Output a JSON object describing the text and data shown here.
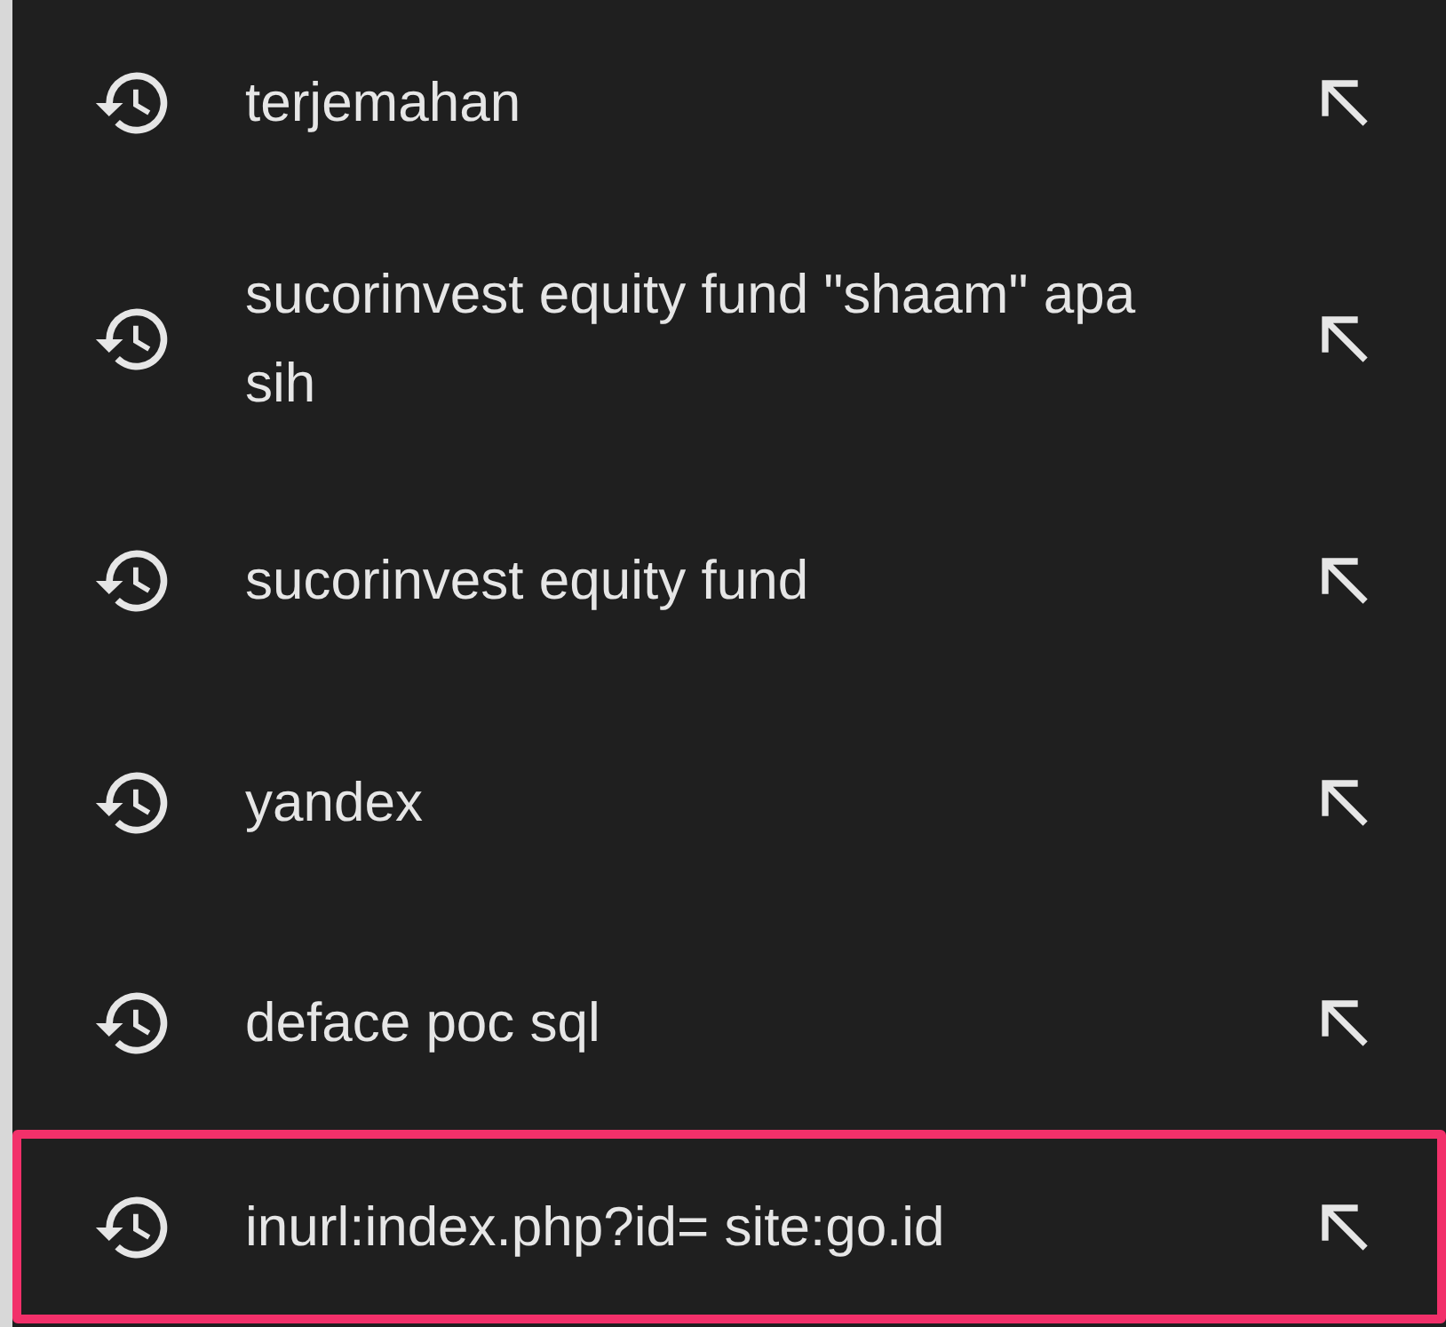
{
  "history": [
    {
      "query": "terjemahan",
      "highlighted": false
    },
    {
      "query": "sucorinvest equity fund \"shaam\" apa sih",
      "highlighted": false
    },
    {
      "query": "sucorinvest equity fund",
      "highlighted": false
    },
    {
      "query": "yandex",
      "highlighted": false
    },
    {
      "query": "deface poc sql",
      "highlighted": false
    },
    {
      "query": "inurl:index.php?id= site:go.id",
      "highlighted": true
    }
  ]
}
